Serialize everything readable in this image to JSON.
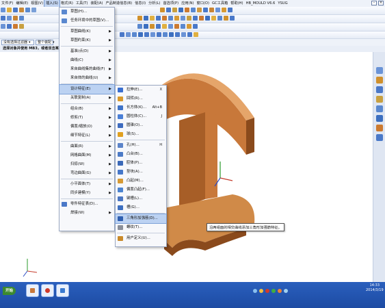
{
  "menubar": {
    "items": [
      "文件(F)",
      "编辑(E)",
      "视图(V)",
      "插入(S)",
      "格式(R)",
      "工具(T)",
      "装配(A)",
      "产品制造信息(B)",
      "信息(I)",
      "分析(L)",
      "首选项(P)",
      "应用(N)",
      "窗口(O)",
      "GC工具箱",
      "帮助(H)",
      "HB_MOULD V6.6",
      "YSUG"
    ],
    "active_index": 3
  },
  "filterbar": {
    "filter_label": "没有选择过滤器",
    "assembly_label": "整个装配"
  },
  "cue": {
    "text": "选择对象并使用 MB3，或者双击某一对象"
  },
  "insert_menu": {
    "items": [
      {
        "label": "草图(H)...",
        "arrow": false
      },
      {
        "label": "任务环境中的草图(V)...",
        "arrow": false
      },
      {
        "label": "草图曲线(K)",
        "arrow": true
      },
      {
        "label": "草图约束(K)",
        "arrow": true
      },
      {
        "label": "基准/点(D)",
        "arrow": true
      },
      {
        "label": "曲线(C)",
        "arrow": true
      },
      {
        "label": "来自曲线集的曲线(F)",
        "arrow": true
      },
      {
        "label": "来自体的曲线(U)",
        "arrow": true
      },
      {
        "label": "设计特征(E)",
        "arrow": true,
        "highlight": true
      },
      {
        "label": "关联复制(A)",
        "arrow": true
      },
      {
        "label": "组合(B)",
        "arrow": true
      },
      {
        "label": "修剪(T)",
        "arrow": true
      },
      {
        "label": "偏置/缩放(O)",
        "arrow": true
      },
      {
        "label": "细节特征(L)",
        "arrow": true
      },
      {
        "label": "曲面(R)",
        "arrow": true
      },
      {
        "label": "网格曲面(M)",
        "arrow": true
      },
      {
        "label": "扫掠(W)",
        "arrow": true
      },
      {
        "label": "弯边曲面(G)",
        "arrow": true
      },
      {
        "label": "小平面体(T)",
        "arrow": true
      },
      {
        "label": "同步建模(Y)",
        "arrow": true
      },
      {
        "label": "零件特征表(D)...",
        "arrow": false
      },
      {
        "label": "焊接(W)",
        "arrow": true
      }
    ]
  },
  "design_feature_menu": {
    "items": [
      {
        "label": "拉伸(E)...",
        "shortcut": "X",
        "color": "#3a6fcf"
      },
      {
        "label": "回转(R)...",
        "shortcut": "",
        "color": "#d99a2b"
      },
      {
        "label": "长方体(K)...",
        "shortcut": "Alt+B",
        "color": "#3f73c8"
      },
      {
        "label": "圆柱体(C)...",
        "shortcut": "J",
        "color": "#4a7fd6"
      },
      {
        "label": "圆锥(O)...",
        "shortcut": "",
        "color": "#3d6bbf"
      },
      {
        "label": "球(S)...",
        "shortcut": "",
        "color": "#e0a020"
      },
      {
        "label": "孔(H)...",
        "shortcut": "H",
        "color": "#5c84c9"
      },
      {
        "label": "凸台(B)...",
        "shortcut": "",
        "color": "#4c7ac6"
      },
      {
        "label": "腔体(P)...",
        "shortcut": "",
        "color": "#3b69b8"
      },
      {
        "label": "垫块(A)...",
        "shortcut": "",
        "color": "#4677c9"
      },
      {
        "label": "凸起(M)...",
        "shortcut": "",
        "color": "#d79a34"
      },
      {
        "label": "偏置凸起(F)...",
        "shortcut": "",
        "color": "#4b83d0"
      },
      {
        "label": "键槽(L)...",
        "shortcut": "",
        "color": "#4a76c2"
      },
      {
        "label": "槽(G)...",
        "shortcut": "",
        "color": "#3d6fc0"
      },
      {
        "label": "三角形加强筋(D)...",
        "shortcut": "",
        "color": "#2f5fb0",
        "highlight": true
      },
      {
        "label": "螺纹(T)...",
        "shortcut": "",
        "color": "#8a8f99"
      },
      {
        "label": "用户定义(U)...",
        "shortcut": "",
        "color": "#c98a2a"
      }
    ]
  },
  "tooltip": {
    "text": "沿两组面的相交曲线添加三角形加强筋特征。"
  },
  "taskbar": {
    "start_label": "开始",
    "clock_time": "14:33",
    "clock_date": "2014/3/19"
  },
  "colors": {
    "part": "#c8783a",
    "part_dark": "#8a4a1c",
    "menu_highlight": "#bcd2f2",
    "taskbar": "#2458b6"
  }
}
